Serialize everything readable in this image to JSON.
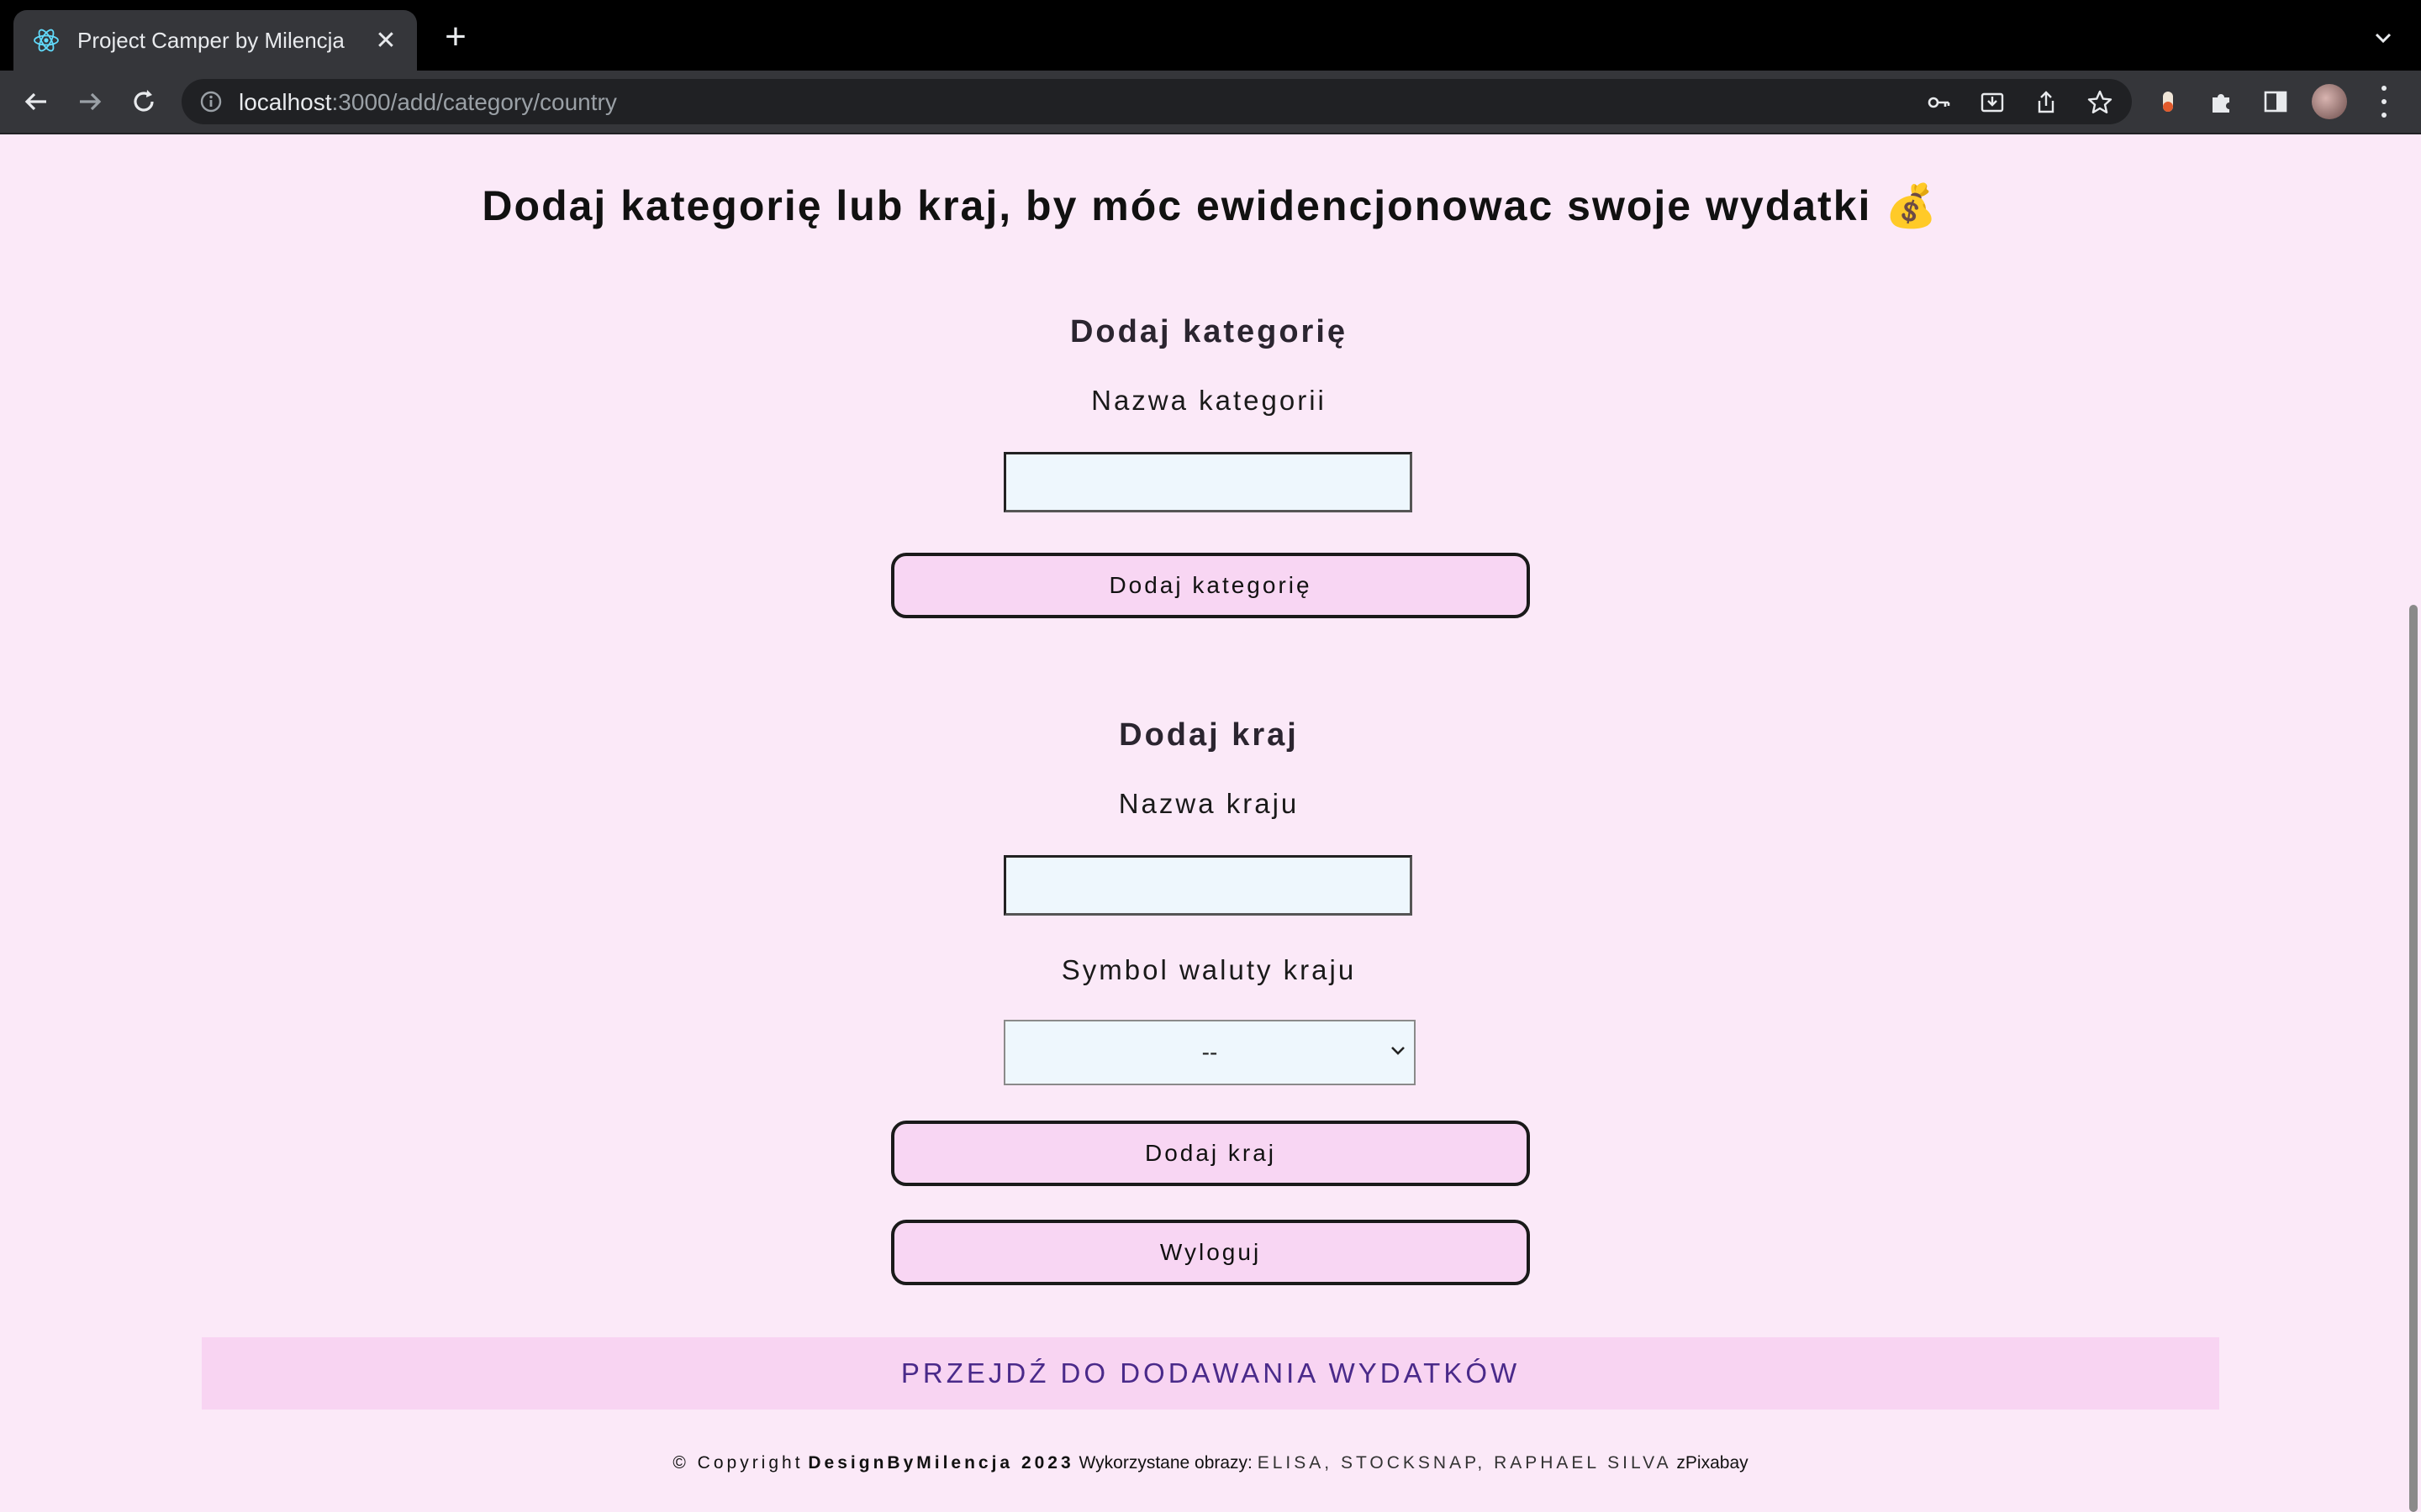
{
  "browser": {
    "tab_title": "Project Camper by Milencja",
    "close_glyph": "✕",
    "new_tab_glyph": "+",
    "url_host": "localhost",
    "url_rest": ":3000/add/category/country"
  },
  "page": {
    "heading": "Dodaj kategorię lub kraj, by móc ewidencjonowac swoje wydatki 💰",
    "category": {
      "title": "Dodaj kategorię",
      "field_label": "Nazwa kategorii",
      "field_value": "",
      "button_label": "Dodaj kategorię"
    },
    "country": {
      "title": "Dodaj kraj",
      "field_label": "Nazwa kraju",
      "field_value": "",
      "currency_label": "Symbol waluty kraju",
      "currency_selected": "--",
      "button_label": "Dodaj kraj"
    },
    "logout_label": "Wyloguj",
    "expenses_link": "PRZEJDŹ DO DODAWANIA WYDATKÓW",
    "footer": {
      "copyright": "© Copyright",
      "brand": "DesignByMilencja 2023",
      "images_used": "Wykorzystane obrazy:",
      "authors": "ELISA, STOCKSNAP, RAPHAEL SILVA",
      "source_prefix": "z",
      "source": "Pixabay"
    }
  },
  "colors": {
    "page_background": "#fbe9f8",
    "button_background": "#f8d6f3",
    "input_background": "#eef7fd",
    "link_text": "#4a2a8a"
  }
}
